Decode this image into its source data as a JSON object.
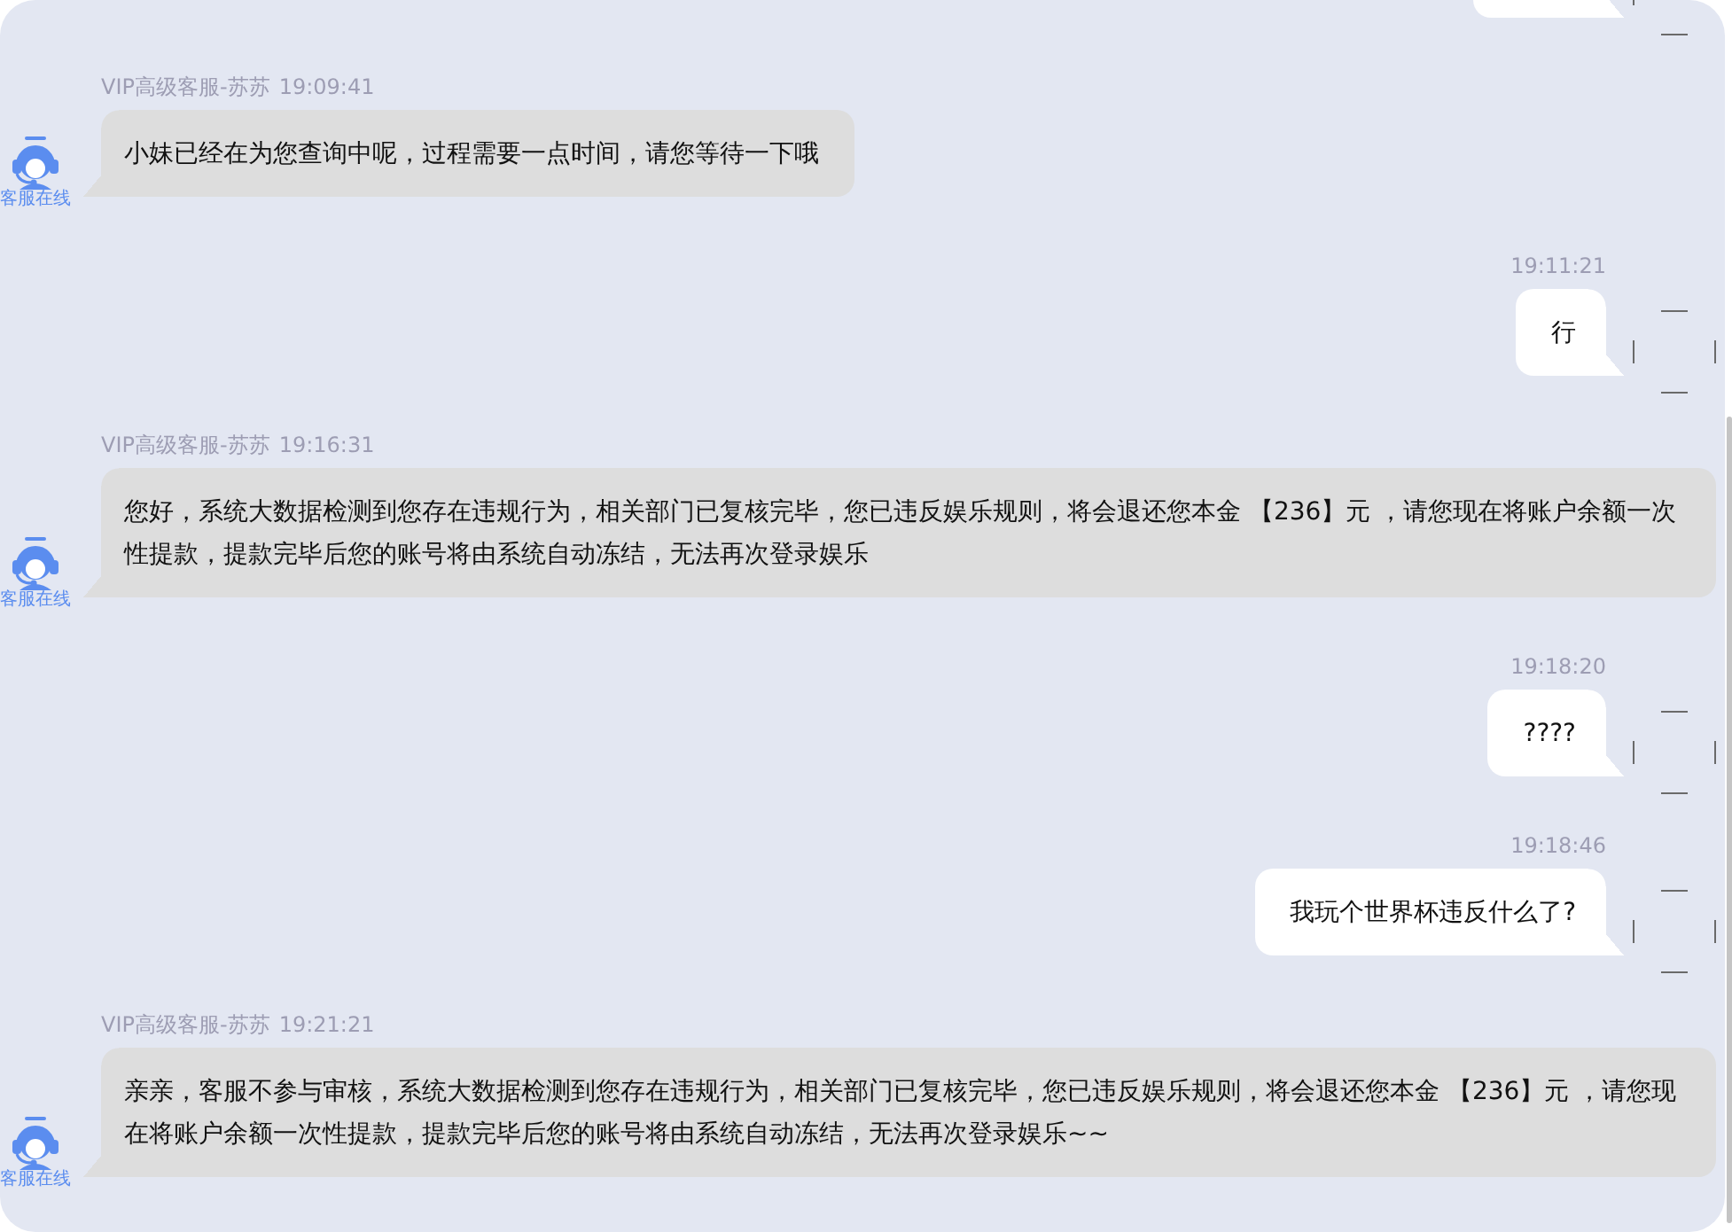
{
  "messages": [
    {
      "kind": "outgoing"
    },
    {
      "kind": "incoming",
      "sender": "VIP高级客服-苏苏",
      "time": "19:09:41",
      "text": "小妹已经在为您查询中呢，过程需要一点时间，请您等待一下哦",
      "avatar_caption": "客服在线"
    },
    {
      "kind": "outgoing",
      "time": "19:11:21",
      "text": "行"
    },
    {
      "kind": "incoming",
      "sender": "VIP高级客服-苏苏",
      "time": "19:16:31",
      "text": "您好，系统大数据检测到您存在违规行为，相关部门已复核完毕，您已违反娱乐规则，将会退还您本金 【236】元 ，请您现在将账户余额一次性提款，提款完毕后您的账号将由系统自动冻结，无法再次登录娱乐",
      "avatar_caption": "客服在线"
    },
    {
      "kind": "outgoing",
      "time": "19:18:20",
      "text": "????"
    },
    {
      "kind": "outgoing",
      "time": "19:18:46",
      "text": "我玩个世界杯违反什么了?"
    },
    {
      "kind": "incoming",
      "sender": "VIP高级客服-苏苏",
      "time": "19:21:21",
      "text": "亲亲，客服不参与审核，系统大数据检测到您存在违规行为，相关部门已复核完毕，您已违反娱乐规则，将会退还您本金 【236】元 ，请您现在将账户余额一次性提款，提款完毕后您的账号将由系统自动冻结，无法再次登录娱乐~~",
      "avatar_caption": "客服在线"
    }
  ]
}
